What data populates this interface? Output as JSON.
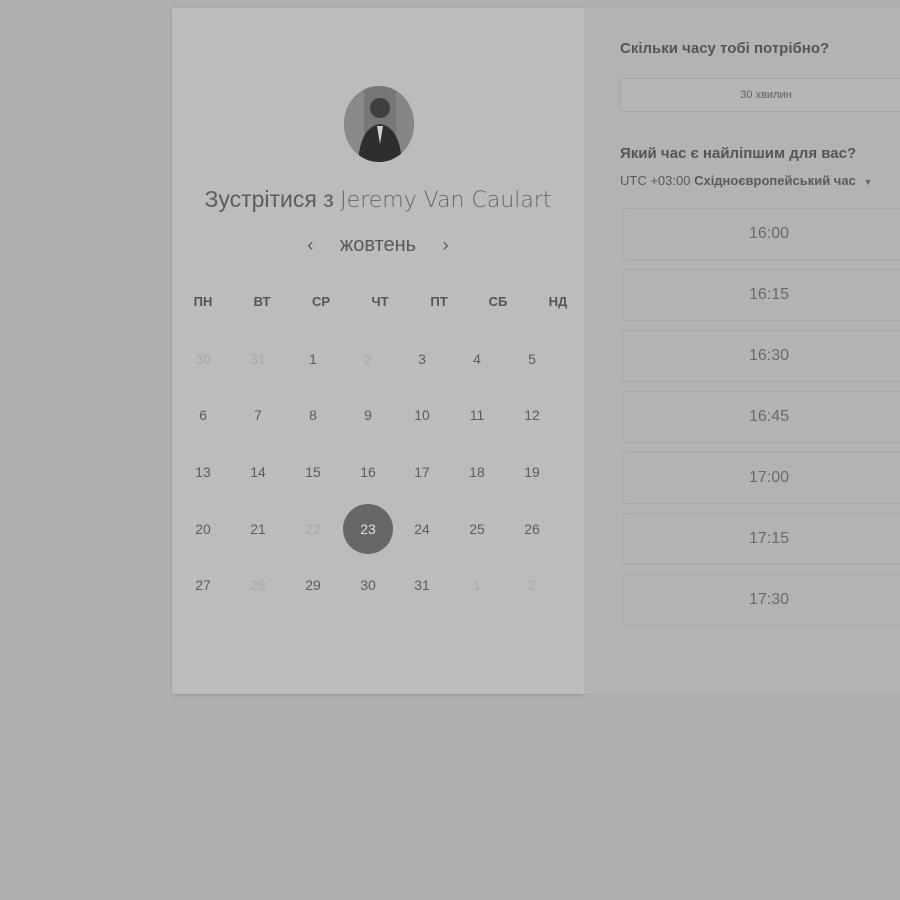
{
  "host": {
    "title_prefix": "Зустрітися з",
    "name": "Jeremy Van Caulart",
    "avatar_icon": "person-photo"
  },
  "calendar": {
    "month": "жовтень",
    "prev_icon": "chevron-left-icon",
    "next_icon": "chevron-right-icon",
    "prev_glyph": "‹",
    "next_glyph": "›",
    "weekdays": [
      "ПН",
      "ВТ",
      "СР",
      "ЧТ",
      "ПТ",
      "СБ",
      "НД"
    ],
    "weeks": [
      [
        {
          "d": "30",
          "muted": true
        },
        {
          "d": "31",
          "muted": true
        },
        {
          "d": "1"
        },
        {
          "d": "2",
          "muted": true
        },
        {
          "d": "3"
        },
        {
          "d": "4"
        },
        {
          "d": "5"
        }
      ],
      [
        {
          "d": "6"
        },
        {
          "d": "7"
        },
        {
          "d": "8"
        },
        {
          "d": "9"
        },
        {
          "d": "10"
        },
        {
          "d": "11"
        },
        {
          "d": "12"
        }
      ],
      [
        {
          "d": "13"
        },
        {
          "d": "14"
        },
        {
          "d": "15"
        },
        {
          "d": "16"
        },
        {
          "d": "17"
        },
        {
          "d": "18"
        },
        {
          "d": "19"
        }
      ],
      [
        {
          "d": "20"
        },
        {
          "d": "21"
        },
        {
          "d": "22",
          "muted": true
        },
        {
          "d": "23",
          "selected": true
        },
        {
          "d": "24"
        },
        {
          "d": "25"
        },
        {
          "d": "26"
        }
      ],
      [
        {
          "d": "27"
        },
        {
          "d": "28",
          "muted": true
        },
        {
          "d": "29"
        },
        {
          "d": "30"
        },
        {
          "d": "31"
        },
        {
          "d": "1",
          "muted": true
        },
        {
          "d": "2",
          "muted": true
        }
      ]
    ],
    "selected_day": "23"
  },
  "booking": {
    "duration_question": "Скільки часу тобі потрібно?",
    "duration_value": "30 хвилин",
    "time_question": "Який час є найліпшим для вас?",
    "timezone_offset": "UTC +03:00",
    "timezone_name": "Східноєвропейський час",
    "timezone_caret_icon": "caret-down-icon",
    "slots": [
      "16:00",
      "16:15",
      "16:30",
      "16:45",
      "17:00",
      "17:15",
      "17:30"
    ]
  },
  "colors": {
    "selected_day_bg": "#676767",
    "overlay_bg": "#b0b0b0"
  }
}
